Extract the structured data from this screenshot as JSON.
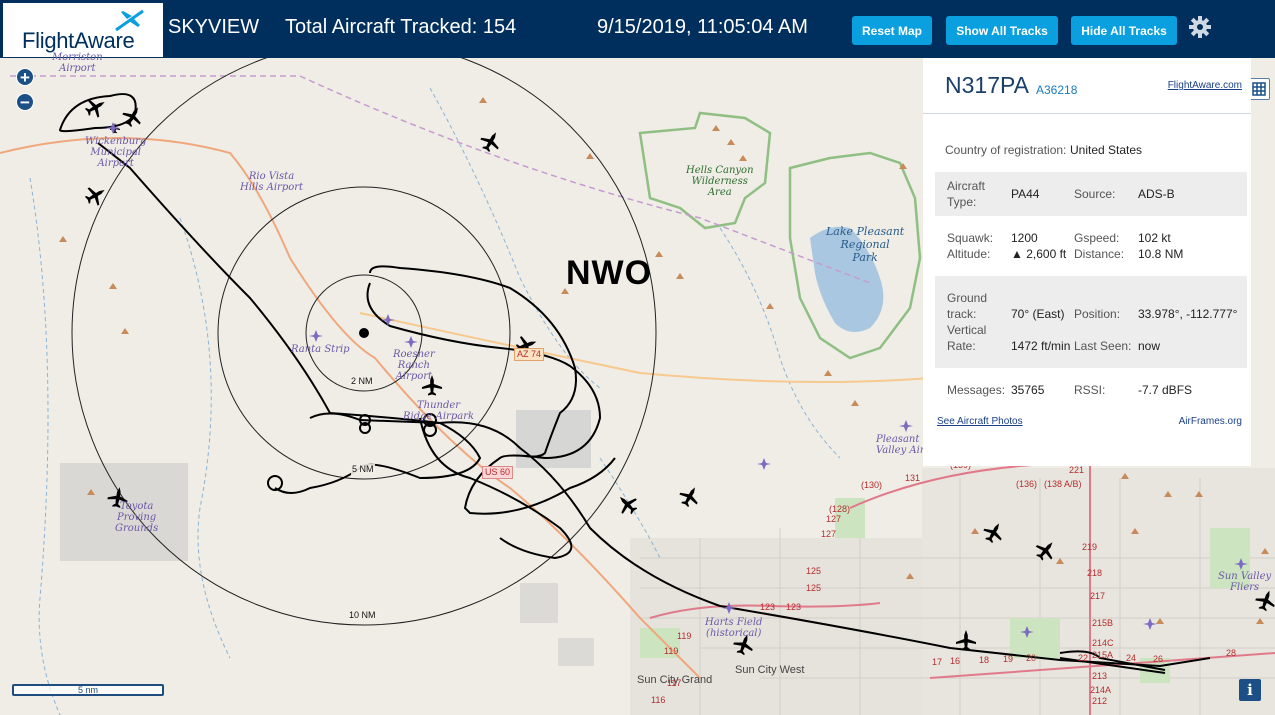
{
  "header": {
    "logo_text": "FlightAware",
    "app_name": "SKYVIEW",
    "total_tracked_label": "Total Aircraft Tracked: 154",
    "datetime": "9/15/2019, 11:05:04 AM",
    "buttons": {
      "reset_map": "Reset Map",
      "show_all_tracks": "Show All Tracks",
      "hide_all_tracks": "Hide All Tracks"
    },
    "colors": {
      "bar": "#002f5d",
      "button": "#0a9fde"
    }
  },
  "map": {
    "zoom_in": "+",
    "zoom_out": "−",
    "station_label": "NWO",
    "rings": {
      "r2": "2 NM",
      "r5": "5 NM",
      "r10": "10 NM"
    },
    "scale": "5 nm",
    "info": "i",
    "airports": {
      "morristown": "Morriston\nAirport",
      "wickenburg": "Wickenburg\nMunicipal\nAirport",
      "rio_vista": "Rio Vista\nHills Airport",
      "ranta": "Ranta Strip",
      "roesner": "Roesner\nRanch\nAirport",
      "thunder": "Thunder\nRidge Airpark",
      "toyota": "Toyota\nProving\nGrounds",
      "pleasant": "Pleasant\nValley Airp",
      "harts": "Harts Field\n(historical)",
      "sun_valley": "Sun Valley\nFliers"
    },
    "areas": {
      "hells_canyon": "Hells Canyon\nWilderness\nArea",
      "lake_pleasant": "Lake Pleasant\nRegional\nPark"
    },
    "towns": {
      "sun_city_grand": "Sun City Grand",
      "sun_city_west": "Sun City West"
    },
    "roads": {
      "az74": "AZ 74",
      "us60": "US 60",
      "r139": "(139)",
      "r221": "221",
      "r136": "(136)",
      "r138": "(138 A/B)",
      "r130": "(130)",
      "r131": "131",
      "r128": "(128)",
      "r127a": "127",
      "r127b": "127",
      "r219": "219",
      "r218": "218",
      "r217": "217",
      "r215b": "215B",
      "r214c": "214C",
      "r215a": "215A",
      "r214a": "214A",
      "r212": "212",
      "r213": "213",
      "r125a": "125",
      "r125b": "125",
      "r123a": "123",
      "r123b": "123",
      "r119a": "119",
      "r119b": "119",
      "r117": "117",
      "r116": "116",
      "r17": "17",
      "r16": "16",
      "r18": "18",
      "r19": "19",
      "r20": "20",
      "r22": "22",
      "r24": "24",
      "r26": "26",
      "r28": "28"
    }
  },
  "panel": {
    "tail": "N317PA",
    "hex": "A36218",
    "fa_link": "FlightAware.com",
    "country_label": "Country of registration:",
    "country_value": "United States",
    "aircraft_type_label": "Aircraft\nType:",
    "aircraft_type_value": "PA44",
    "source_label": "Source:",
    "source_value": "ADS-B",
    "squawk_label": "Squawk:",
    "squawk_value": "1200",
    "altitude_label": "Altitude:",
    "altitude_value": "▲ 2,600 ft",
    "gspeed_label": "Gspeed:",
    "gspeed_value": "102 kt",
    "distance_label": "Distance:",
    "distance_value": "10.8 NM",
    "ground_track_label": "Ground\ntrack:",
    "ground_track_value": "70° (East)",
    "vertical_rate_label": "Vertical\nRate:",
    "vertical_rate_value": "1472 ft/min",
    "position_label": "Position:",
    "position_value": "33.978°, -112.777°",
    "last_seen_label": "Last Seen:",
    "last_seen_value": "now",
    "messages_label": "Messages:",
    "messages_value": "35765",
    "rssi_label": "RSSI:",
    "rssi_value": "-7.7 dBFS",
    "photos_link": "See Aircraft Photos",
    "airframes_link": "AirFrames.org"
  }
}
